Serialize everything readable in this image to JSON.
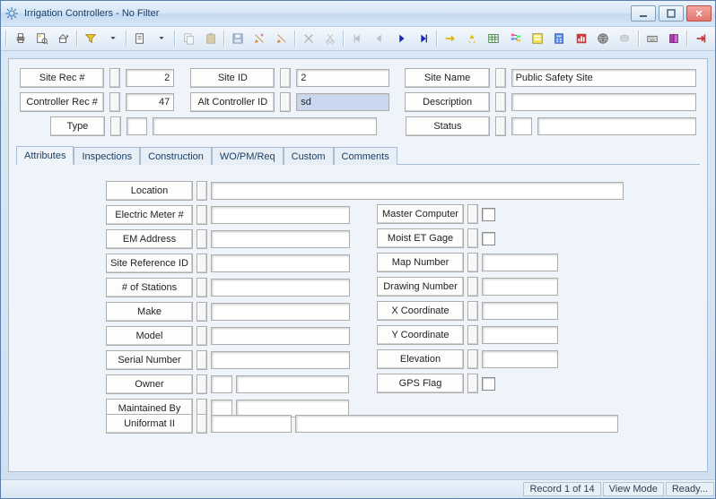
{
  "window": {
    "title": "Irrigation Controllers - No Filter"
  },
  "header": {
    "siteRecNo": {
      "label": "Site Rec #",
      "value": "2"
    },
    "siteId": {
      "label": "Site ID",
      "value": "2"
    },
    "siteName": {
      "label": "Site Name",
      "value": "Public Safety Site"
    },
    "controllerRecNo": {
      "label": "Controller Rec #",
      "value": "47"
    },
    "altControllerId": {
      "label": "Alt Controller ID",
      "value": "sd"
    },
    "description": {
      "label": "Description",
      "value": ""
    },
    "type": {
      "label": "Type",
      "value": ""
    },
    "status": {
      "label": "Status",
      "value": ""
    }
  },
  "tabs": [
    "Attributes",
    "Inspections",
    "Construction",
    "WO/PM/Req",
    "Custom",
    "Comments"
  ],
  "attrLeft": {
    "location": "Location",
    "electricMeter": "Electric Meter #",
    "emAddress": "EM Address",
    "siteRefId": "Site Reference ID",
    "numStations": "# of Stations",
    "make": "Make",
    "model": "Model",
    "serial": "Serial Number",
    "owner": "Owner",
    "maintainedBy": "Maintained By",
    "uniformat": "Uniformat II"
  },
  "attrRight": {
    "masterComputer": "Master Computer",
    "moistEtGage": "Moist ET Gage",
    "mapNumber": "Map Number",
    "drawingNumber": "Drawing Number",
    "xCoord": "X Coordinate",
    "yCoord": "Y Coordinate",
    "elevation": "Elevation",
    "gpsFlag": "GPS Flag"
  },
  "status": {
    "record": "Record 1 of 14",
    "mode": "View Mode",
    "ready": "Ready..."
  }
}
